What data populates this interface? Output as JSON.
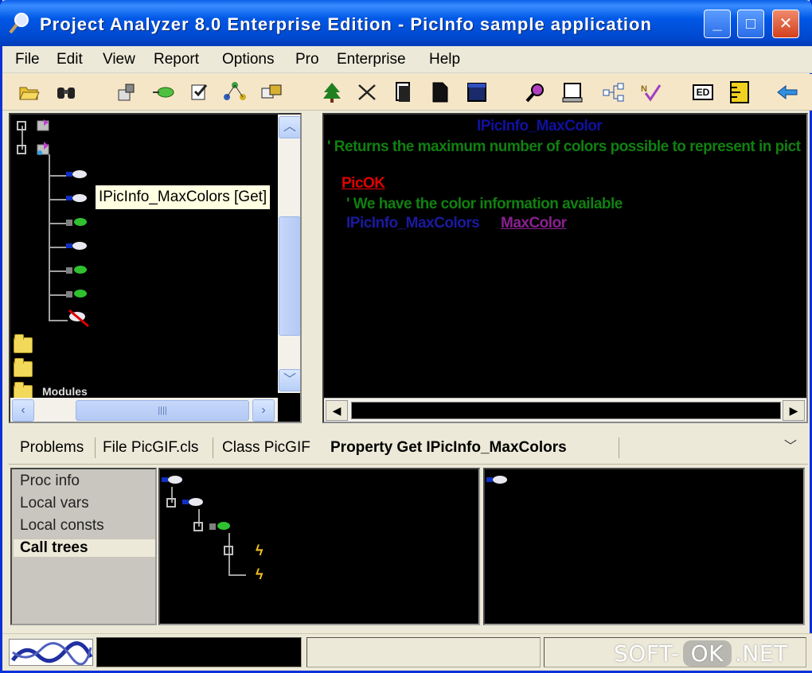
{
  "window": {
    "title": "Project Analyzer 8.0 Enterprise Edition - PicInfo sample application",
    "minimize": "_",
    "maximize": "□",
    "close": "✕"
  },
  "menu": [
    "File",
    "Edit",
    "View",
    "Report",
    "Options",
    "Pro",
    "Enterprise",
    "Help"
  ],
  "toolbar_icons": [
    "open-folder-icon",
    "binoculars-icon",
    "properties-icon",
    "leaf-arrow-icon",
    "checklist-icon",
    "network-icon",
    "dialog-icon",
    "tree-icon",
    "shuffle-icon",
    "document-copy-icon",
    "document-icon",
    "window-icon",
    "magnifier-icon",
    "report-icon",
    "hierarchy-icon",
    "checkmark-icon",
    "ed-icon",
    "ruler-icon",
    "back-arrow-icon"
  ],
  "toolbar_ed": "ED",
  "tree": {
    "tooltip": "IPicInfo_MaxColors [Get]",
    "modules_label": "Modules"
  },
  "code": {
    "heading": "IPicInfo_MaxColor",
    "comment1": "' Returns the maximum number of colors possible to represent in pict",
    "label": "PicOK",
    "comment2": "' We have the color information available",
    "ident": "IPicInfo_MaxColors",
    "prop": "MaxColor"
  },
  "tabs": [
    {
      "label": "Problems"
    },
    {
      "label": "File PicGIF.cls"
    },
    {
      "label": "Class PicGIF"
    },
    {
      "label": "Property Get IPicInfo_MaxColors"
    }
  ],
  "side_items": [
    "Proc info",
    "Local vars",
    "Local consts",
    "Call trees"
  ],
  "watermark": {
    "soft": "SOFT-",
    "ok": "OK",
    "net": ".NET"
  },
  "colors": {
    "title_bar": "#0058E6",
    "toolbar_bg": "#F6E6C8",
    "pane_bg": "#000000"
  }
}
